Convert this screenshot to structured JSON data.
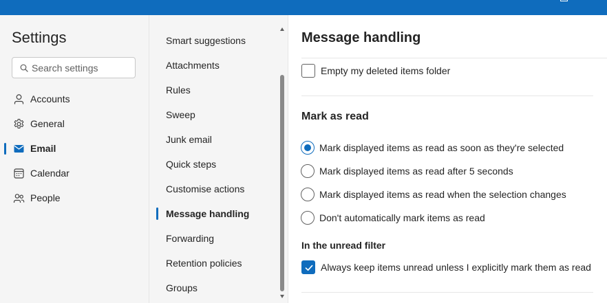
{
  "window": {
    "accent_color": "#0f6cbd",
    "controls": [
      "minimize-icon",
      "maximize-icon",
      "close-icon"
    ]
  },
  "sidebar": {
    "title": "Settings",
    "search": {
      "placeholder": "Search settings",
      "value": ""
    },
    "items": [
      {
        "label": "Accounts",
        "icon": "person-icon",
        "active": false
      },
      {
        "label": "General",
        "icon": "gear-icon",
        "active": false
      },
      {
        "label": "Email",
        "icon": "mail-icon",
        "active": true
      },
      {
        "label": "Calendar",
        "icon": "calendar-icon",
        "active": false
      },
      {
        "label": "People",
        "icon": "people-icon",
        "active": false
      }
    ]
  },
  "email_menu": {
    "items": [
      {
        "label": "Smart suggestions",
        "active": false
      },
      {
        "label": "Attachments",
        "active": false
      },
      {
        "label": "Rules",
        "active": false
      },
      {
        "label": "Sweep",
        "active": false
      },
      {
        "label": "Junk email",
        "active": false
      },
      {
        "label": "Quick steps",
        "active": false
      },
      {
        "label": "Customise actions",
        "active": false
      },
      {
        "label": "Message handling",
        "active": true
      },
      {
        "label": "Forwarding",
        "active": false
      },
      {
        "label": "Retention policies",
        "active": false
      },
      {
        "label": "Groups",
        "active": false
      }
    ]
  },
  "content": {
    "title": "Message handling",
    "empty_deleted": {
      "label": "Empty my deleted items folder",
      "checked": false
    },
    "mark_as_read": {
      "title": "Mark as read",
      "options": [
        {
          "label": "Mark displayed items as read as soon as they're selected",
          "selected": true
        },
        {
          "label": "Mark displayed items as read after 5 seconds",
          "selected": false
        },
        {
          "label": "Mark displayed items as read when the selection changes",
          "selected": false
        },
        {
          "label": "Don't automatically mark items as read",
          "selected": false
        }
      ]
    },
    "unread_filter": {
      "title": "In the unread filter",
      "option": {
        "label": "Always keep items unread unless I explicitly mark them as read",
        "checked": true
      }
    }
  }
}
